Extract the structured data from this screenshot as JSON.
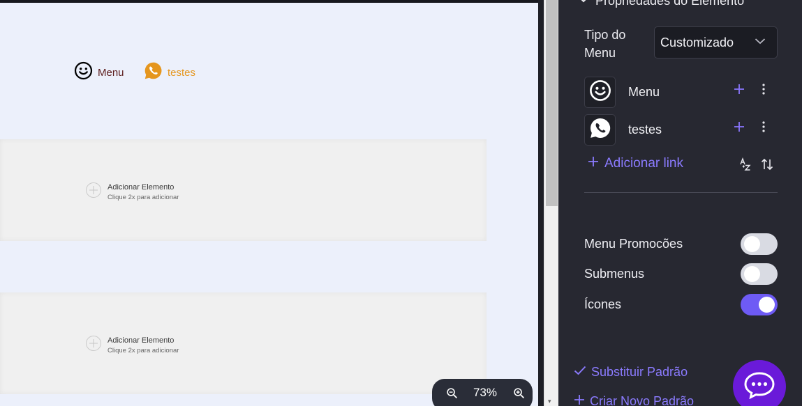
{
  "canvas": {
    "menu_items": [
      {
        "label": "Menu",
        "icon": "smiley-icon",
        "color": "#5a1a1a"
      },
      {
        "label": "testes",
        "icon": "whatsapp-icon",
        "color": "#e5961e"
      }
    ],
    "blocks": [
      {
        "title": "Adicionar Elemento",
        "subtitle": "Clique 2x para adicionar"
      },
      {
        "title": "Adicionar Elemento",
        "subtitle": "Clique 2x para adicionar"
      }
    ],
    "zoom": {
      "level": "73%"
    }
  },
  "panel": {
    "section_title": "Propriedades do Elemento",
    "tipo_menu_label": "Tipo do Menu",
    "tipo_menu_value": "Customizado",
    "links": [
      {
        "label": "Menu",
        "icon": "smiley-icon"
      },
      {
        "label": "testes",
        "icon": "whatsapp-icon"
      }
    ],
    "add_link_label": "Adicionar link",
    "toggles": [
      {
        "label": "Menu Promocões",
        "on": false
      },
      {
        "label": "Submenus",
        "on": false
      },
      {
        "label": "Ícones",
        "on": true
      }
    ],
    "substituir_padrao": "Substituir Padrão",
    "criar_novo_padrao": "Criar Novo Padrão"
  },
  "colors": {
    "accent": "#8b7bff",
    "toggle_on": "#6e5bf5",
    "panel_bg": "#272831",
    "canvas_bg": "#ecf0fb",
    "chat_fab": "#6a1ad9"
  }
}
